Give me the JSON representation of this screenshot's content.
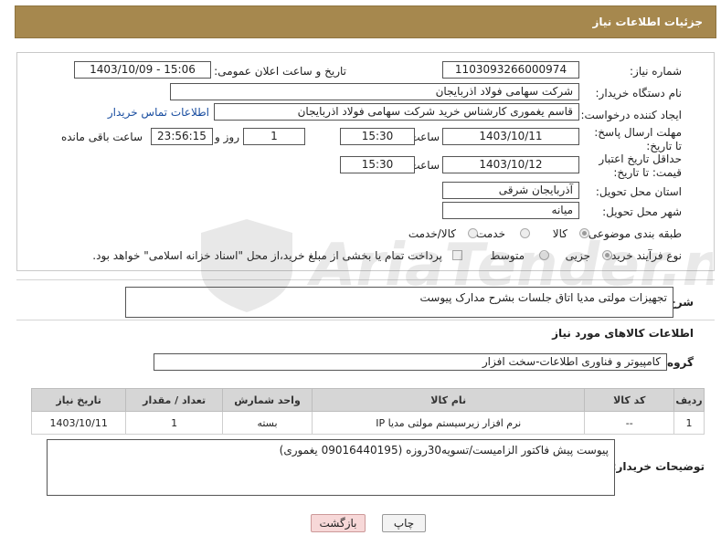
{
  "header": {
    "title": "جزئیات اطلاعات نیاز"
  },
  "form": {
    "need_number_label": "شماره نیاز:",
    "need_number": "1103093266000974",
    "announce_label": "تاریخ و ساعت اعلان عمومی:",
    "announce_value": "1403/10/09 - 15:06",
    "buyer_org_label": "نام دستگاه خریدار:",
    "buyer_org": "شرکت سهامی فولاد اذربایجان",
    "creator_label": "ایجاد کننده درخواست:",
    "creator": "قاسم یغموری کارشناس خرید شرکت سهامی فولاد اذربایجان",
    "contact_link": "اطلاعات تماس خریدار",
    "reply_deadline_label": "مهلت ارسال پاسخ: تا تاریخ:",
    "reply_date": "1403/10/11",
    "time_label": "ساعت",
    "reply_time": "15:30",
    "days_value": "1",
    "days_label": "روز و",
    "remaining_time": "23:56:15",
    "remaining_label": "ساعت باقی مانده",
    "price_validity_label": "حداقل تاریخ اعتبار قیمت: تا تاریخ:",
    "price_date": "1403/10/12",
    "price_time": "15:30",
    "province_label": "استان محل تحویل:",
    "province": "آذربایجان شرقی",
    "city_label": "شهر محل تحویل:",
    "city": "میانه",
    "category_label": "طبقه بندی موضوعی:",
    "category_options": [
      "کالا",
      "خدمت",
      "کالا/خدمت"
    ],
    "process_label": "نوع فرآیند خرید :",
    "process_options": [
      "جزیی",
      "متوسط"
    ],
    "payment_note": "پرداخت تمام یا بخشی از مبلغ خرید،از محل \"اسناد خزانه اسلامی\" خواهد بود."
  },
  "summary": {
    "label": "شرح کلی نیاز:",
    "value": "تجهیزات مولتی مدیا اتاق جلسات بشرح مدارک پیوست"
  },
  "goods_section": {
    "title": "اطلاعات کالاهای مورد نیاز",
    "group_label": "گروه کالا:",
    "group_value": "کامپیوتر و فناوری اطلاعات-سخت افزار"
  },
  "table": {
    "headers": [
      "ردیف",
      "کد کالا",
      "نام کالا",
      "واحد شمارش",
      "تعداد / مقدار",
      "تاریخ نیاز"
    ],
    "rows": [
      [
        "1",
        "--",
        "نرم افزار زیرسیستم مولتی مدیا IP",
        "بسته",
        "1",
        "1403/10/11"
      ]
    ]
  },
  "buyer_notes": {
    "label": "توضیحات خریدار:",
    "value": "پیوست پیش فاکتور الزامیست/تسویه30روزه (09016440195 یغموری)"
  },
  "buttons": {
    "print": "چاپ",
    "back": "بازگشت"
  },
  "watermark": {
    "text": "AriaTender.net"
  },
  "colors": {
    "header_bg": "#a6884e",
    "link": "#1a4ea0",
    "back_button_bg": "#f7d8d8"
  }
}
